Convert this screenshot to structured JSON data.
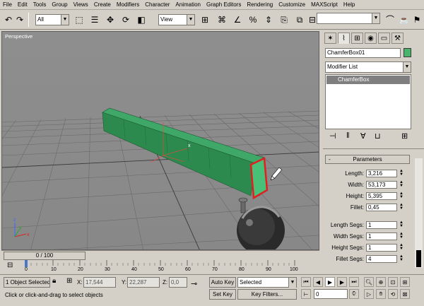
{
  "menu": [
    "File",
    "Edit",
    "Tools",
    "Group",
    "Views",
    "Create",
    "Modifiers",
    "Character",
    "Animation",
    "Graph Editors",
    "Rendering",
    "Customize",
    "MAXScript",
    "Help"
  ],
  "toolbar": {
    "selection_filter": "All",
    "ref_coord": "View"
  },
  "viewport": {
    "label": "Perspective",
    "gizmo_axis_x": "x",
    "gizmo_axis_y": "y",
    "gizmo_axis_z": "z"
  },
  "command_panel": {
    "object_name": "ChamferBox01",
    "object_color": "#47b36c",
    "modifier_list": "Modifier List",
    "stack_items": [
      "ChamferBox"
    ],
    "rollout_title": "Parameters",
    "params": [
      {
        "label": "Length:",
        "value": "3,216"
      },
      {
        "label": "Width:",
        "value": "53,173"
      },
      {
        "label": "Height:",
        "value": "5,395"
      },
      {
        "label": "Fillet:",
        "value": "0,45"
      },
      {
        "label": "Length Segs:",
        "value": "1"
      },
      {
        "label": "Width Segs:",
        "value": "1"
      },
      {
        "label": "Height Segs:",
        "value": "1"
      },
      {
        "label": "Fillet Segs:",
        "value": "4"
      }
    ]
  },
  "timeline": {
    "frame_display": "0 / 100",
    "ruler": [
      "0",
      "10",
      "20",
      "30",
      "40",
      "50",
      "60",
      "70",
      "80",
      "90",
      "100"
    ]
  },
  "status": {
    "selection": "1 Object Selected",
    "prompt": "Click or click-and-drag to select objects",
    "x_label": "X:",
    "x_value": "17,544",
    "y_label": "Y:",
    "y_value": "22,287",
    "z_label": "Z:",
    "z_value": "0,0",
    "auto_key": "Auto Key",
    "key_mode": "Selected",
    "set_key": "Set Key",
    "key_filters": "Key Filters...",
    "current_frame": "0"
  },
  "colors": {
    "ui_gray": "#d4d0c8",
    "viewport_bg": "#8b8b8b",
    "box_green": "#2f9a55",
    "selection_red": "#e02020"
  }
}
